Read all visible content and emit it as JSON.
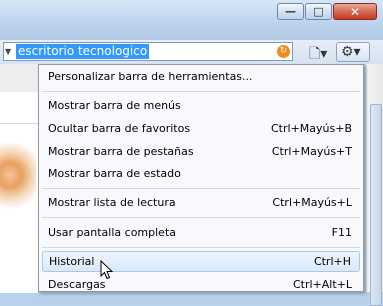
{
  "window_controls": {
    "minimize": "—",
    "maximize": "□",
    "close": "✕"
  },
  "search": {
    "value": "escritorio tecnologico",
    "dropdown_glyph": "▼",
    "go_glyph": "↻"
  },
  "toolbar": {
    "page_glyph": "🗋▾",
    "tools_glyph": "⚙▾"
  },
  "menu": {
    "items": [
      {
        "label": "Personalizar barra de herramientas...",
        "shortcut": ""
      },
      {
        "label": "Mostrar barra de menús",
        "shortcut": ""
      },
      {
        "label": "Ocultar barra de favoritos",
        "shortcut": "Ctrl+Mayús+B"
      },
      {
        "label": "Mostrar barra de pestañas",
        "shortcut": "Ctrl+Mayús+T"
      },
      {
        "label": "Mostrar barra de estado",
        "shortcut": ""
      },
      {
        "label": "Mostrar lista de lectura",
        "shortcut": "Ctrl+Mayús+L"
      },
      {
        "label": "Usar pantalla completa",
        "shortcut": "F11"
      },
      {
        "label": "Historial",
        "shortcut": "Ctrl+H"
      },
      {
        "label": "Descargas",
        "shortcut": "Ctrl+Alt+L"
      }
    ]
  },
  "colors": {
    "selection": "#3399ff",
    "menu_background": "#f7f9fc",
    "highlight_border": "#a8c8ea",
    "close_button": "#c33b22"
  }
}
